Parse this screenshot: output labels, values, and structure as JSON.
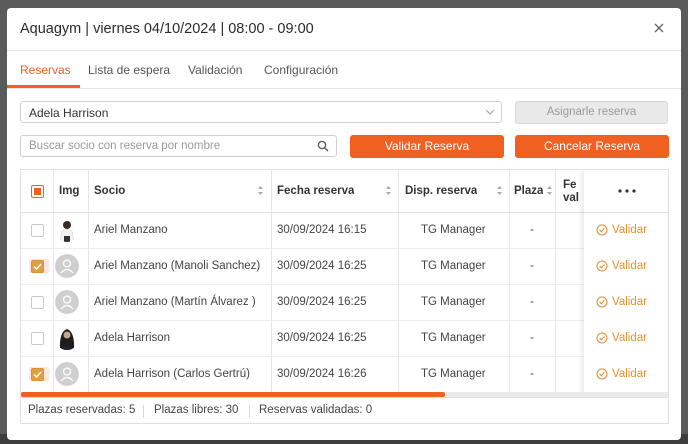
{
  "modal": {
    "title": "Aquagym | viernes 04/10/2024 | 08:00 - 09:00"
  },
  "tabs": [
    {
      "label": "Reservas",
      "active": true
    },
    {
      "label": "Lista de espera",
      "active": false
    },
    {
      "label": "Validación",
      "active": false
    },
    {
      "label": "Configuración",
      "active": false
    }
  ],
  "controls": {
    "member_select_value": "Adela Harrison",
    "assign_button": "Asignarle reserva",
    "search_placeholder": "Buscar socio con reserva por nombre",
    "validate_button": "Validar Reserva",
    "cancel_button": "Cancelar Reserva"
  },
  "table": {
    "headers": [
      "Img",
      "Socio",
      "Fecha reserva",
      "Disp. reserva",
      "Plaza",
      "Fe\nval"
    ],
    "header_fecha_val_line1": "Fe",
    "header_fecha_val_line2": "val",
    "rows": [
      {
        "checked": false,
        "avatar": "photo-man",
        "socio": "Ariel Manzano",
        "fecha": "30/09/2024 16:15",
        "disp": "TG Manager",
        "plaza": "-",
        "action": "Validar"
      },
      {
        "checked": true,
        "avatar": "placeholder",
        "socio": "Ariel Manzano (Manoli Sanchez)",
        "fecha": "30/09/2024 16:25",
        "disp": "TG Manager",
        "plaza": "-",
        "action": "Validar"
      },
      {
        "checked": false,
        "avatar": "placeholder",
        "socio": "Ariel Manzano (Martín Álvarez )",
        "fecha": "30/09/2024 16:25",
        "disp": "TG Manager",
        "plaza": "-",
        "action": "Validar"
      },
      {
        "checked": false,
        "avatar": "photo-woman",
        "socio": "Adela Harrison",
        "fecha": "30/09/2024 16:25",
        "disp": "TG Manager",
        "plaza": "-",
        "action": "Validar"
      },
      {
        "checked": true,
        "avatar": "placeholder",
        "socio": "Adela Harrison (Carlos Gertrú)",
        "fecha": "30/09/2024 16:26",
        "disp": "TG Manager",
        "plaza": "-",
        "action": "Validar"
      }
    ]
  },
  "footer": {
    "reserved": "Plazas reservadas: 5",
    "free": "Plazas libres: 30",
    "validated": "Reservas validadas: 0"
  },
  "colors": {
    "accent": "#f06021",
    "check": "#e1a03f",
    "validate": "#e0923a"
  }
}
